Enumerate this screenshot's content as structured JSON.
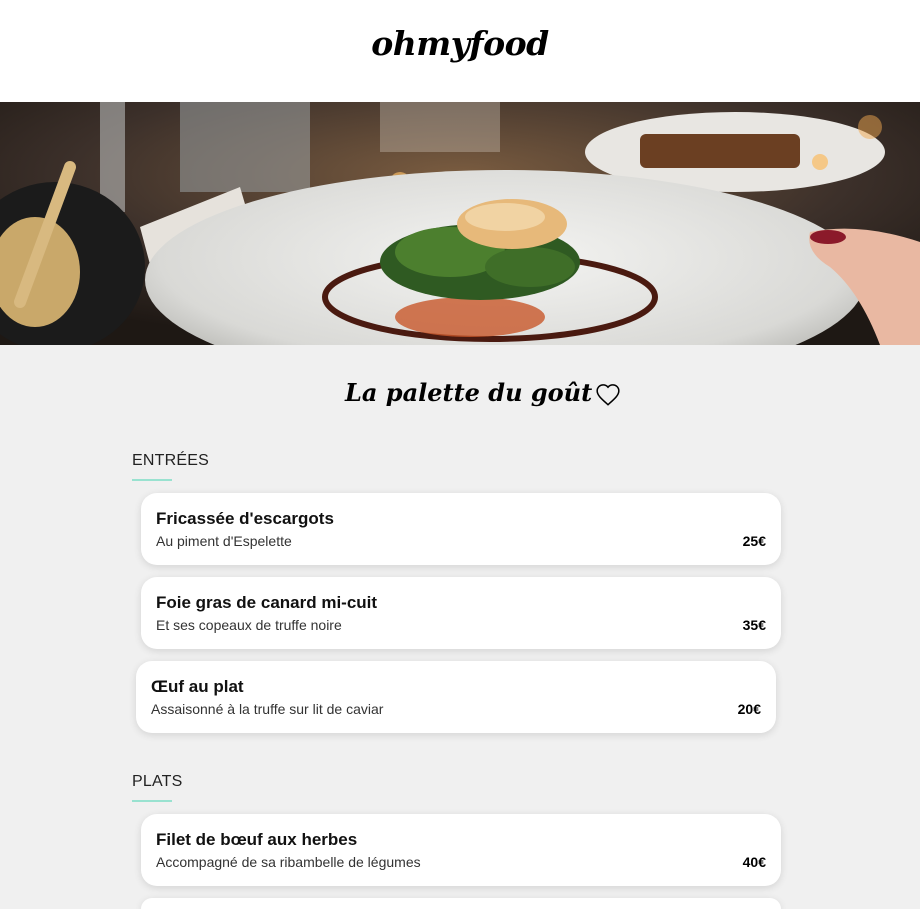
{
  "header": {
    "logo": "ohmyfood"
  },
  "hero": {
    "alt_description_icon": "hero-photo"
  },
  "restaurant": {
    "name": "La palette du goût",
    "favorite_icon": "heart-outline-icon"
  },
  "sections": [
    {
      "title": "ENTRÉES",
      "dishes": [
        {
          "name": "Fricassée d'escargots",
          "description": "Au piment d'Espelette",
          "price": "25€"
        },
        {
          "name": "Foie gras de canard mi-cuit",
          "description": "Et ses copeaux de truffe noire",
          "price": "35€"
        },
        {
          "name": "Œuf au plat",
          "description": "Assaisonné à la truffe sur lit de caviar",
          "price": "20€"
        }
      ]
    },
    {
      "title": "PLATS",
      "dishes": [
        {
          "name": "Filet de bœuf aux herbes",
          "description": "Accompagné de sa ribambelle de légumes",
          "price": "40€"
        }
      ]
    }
  ],
  "colors": {
    "accent_line": "#99e2d0",
    "background": "#f0f0f0",
    "card": "#ffffff"
  }
}
